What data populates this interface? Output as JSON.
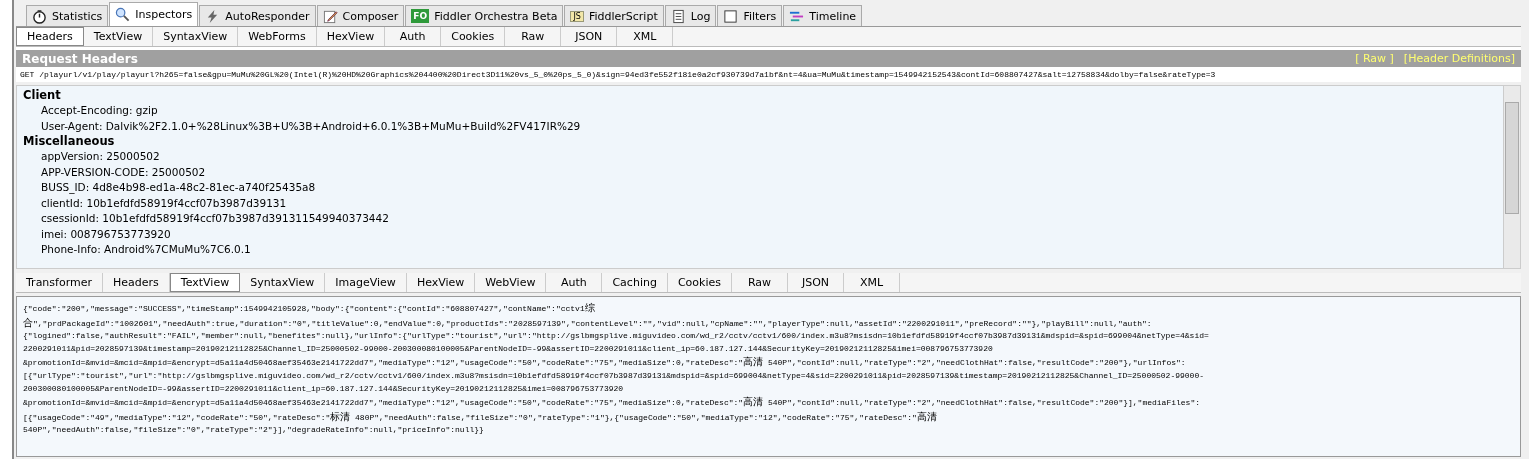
{
  "top_tabs": [
    {
      "label": "Statistics",
      "kind": "stopwatch",
      "selected": false
    },
    {
      "label": "Inspectors",
      "kind": "magnifier",
      "selected": true
    },
    {
      "label": "AutoResponder",
      "kind": "lightning",
      "selected": false
    },
    {
      "label": "Composer",
      "kind": "pencil",
      "selected": false
    },
    {
      "label": "Fiddler Orchestra Beta",
      "kind": "badge",
      "badge": "FO",
      "selected": false
    },
    {
      "label": "FiddlerScript",
      "kind": "script",
      "badge": "JS",
      "selected": false
    },
    {
      "label": "Log",
      "kind": "document",
      "selected": false
    },
    {
      "label": "Filters",
      "kind": "checkbox",
      "selected": false
    },
    {
      "label": "Timeline",
      "kind": "timeline",
      "selected": false
    }
  ],
  "request": {
    "tabs": [
      {
        "label": "Headers",
        "selected": true
      },
      {
        "label": "TextView",
        "selected": false
      },
      {
        "label": "SyntaxView",
        "selected": false
      },
      {
        "label": "WebForms",
        "selected": false
      },
      {
        "label": "HexView",
        "selected": false
      },
      {
        "label": "Auth",
        "selected": false
      },
      {
        "label": "Cookies",
        "selected": false
      },
      {
        "label": "Raw",
        "selected": false
      },
      {
        "label": "JSON",
        "selected": false
      },
      {
        "label": "XML",
        "selected": false
      }
    ],
    "title": "Request Headers",
    "links": [
      "[ Raw ]",
      "[Header Definitions]"
    ],
    "request_line": "GET /playurl/v1/play/playurl?h265=false&gpu=MuMu%20GL%20(Intel(R)%20HD%20Graphics%204400%20Direct3D11%20vs_5_0%20ps_5_0)&sign=94ed3fe552f181e0a2cf930739d7a1bf&nt=4&ua=MuMu&timestamp=1549942152543&contId=608807427&salt=12758834&dolby=false&rateType=3",
    "groups": [
      {
        "name": "Client",
        "headers": [
          "Accept-Encoding: gzip",
          "User-Agent: Dalvik%2F2.1.0+%28Linux%3B+U%3B+Android+6.0.1%3B+MuMu+Build%2FV417IR%29"
        ]
      },
      {
        "name": "Miscellaneous",
        "headers": [
          "appVersion: 25000502",
          "APP-VERSION-CODE: 25000502",
          "BUSS_ID: 4d8e4b98-ed1a-48c2-81ec-a740f25435a8",
          "clientId: 10b1efdfd58919f4ccf07b3987d39131",
          "csessionId: 10b1efdfd58919f4ccf07b3987d391311549940373442",
          "imei: 008796753773920",
          "Phone-Info: Android%7CMuMu%7C6.0.1"
        ]
      }
    ]
  },
  "response": {
    "tabs": [
      {
        "label": "Transformer",
        "selected": false
      },
      {
        "label": "Headers",
        "selected": false
      },
      {
        "label": "TextView",
        "selected": true
      },
      {
        "label": "SyntaxView",
        "selected": false
      },
      {
        "label": "ImageView",
        "selected": false
      },
      {
        "label": "HexView",
        "selected": false
      },
      {
        "label": "WebView",
        "selected": false
      },
      {
        "label": "Auth",
        "selected": false
      },
      {
        "label": "Caching",
        "selected": false
      },
      {
        "label": "Cookies",
        "selected": false
      },
      {
        "label": "Raw",
        "selected": false
      },
      {
        "label": "JSON",
        "selected": false
      },
      {
        "label": "XML",
        "selected": false
      }
    ],
    "body_lines": [
      "{\"code\":\"200\",\"message\":\"SUCCESS\",\"timeStamp\":1549942105928,\"body\":{\"content\":{\"contId\":\"608807427\",\"contName\":\"cctv1综",
      "合\",\"prdPackageId\":\"1002601\",\"needAuth\":true,\"duration\":\"0\",\"titleValue\":0,\"endValue\":0,\"productIds\":\"2028597139\",\"contentLevel\":\"\",\"vid\":null,\"cpName\":\"\",\"playerType\":null,\"assetId\":\"2200291011\",\"preRecord\":\"\"},\"playBill\":null,\"auth\":",
      "{\"logined\":false,\"authResult\":\"FAIL\",\"member\":null,\"benefites\":null},\"urlInfo\":{\"urlType\":\"tourist\",\"url\":\"http://gslbmgsplive.miguvideo.com/wd_r2/cctv/cctv1/600/index.m3u8?msisdn=10b1efdfd58919f4ccf07b3987d39131&mdspid=&spid=699004&netType=4&sid=",
      "2200291011&pid=2028597139&timestamp=20190212112825&Channel_ID=25000502-99000-200300080100005&ParentNodeID=-99&assertID=2200291011&client_ip=60.187.127.144&SecurityKey=20190212112825&imei=008796753773920",
      "&promotionId=&mvid=&mcid=&mpid=&encrypt=d5a11a4d50468aef35463e2141722dd7\",\"mediaType\":\"12\",\"usageCode\":\"50\",\"codeRate\":\"75\",\"mediaSize\":0,\"rateDesc\":\"高清 540P\",\"contId\":null,\"rateType\":\"2\",\"needClothHat\":false,\"resultCode\":\"200\"},\"urlInfos\":",
      "[{\"urlType\":\"tourist\",\"url\":\"http://gslbmgsplive.miguvideo.com/wd_r2/cctv/cctv1/600/index.m3u8?msisdn=10b1efdfd58919f4ccf07b3987d39131&mdspid=&spid=699004&netType=4&sid=2200291011&pid=2028597139&timestamp=20190212112825&Channel_ID=25000502-99000-",
      "200300080100005&ParentNodeID=-99&assertID=2200291011&client_ip=60.187.127.144&SecurityKey=20190212112825&imei=008796753773920",
      "&promotionId=&mvid=&mcid=&mpid=&encrypt=d5a11a4d50468aef35463e2141722dd7\",\"mediaType\":\"12\",\"usageCode\":\"50\",\"codeRate\":\"75\",\"mediaSize\":0,\"rateDesc\":\"高清 540P\",\"contId\":null,\"rateType\":\"2\",\"needClothHat\":false,\"resultCode\":\"200\"}],\"mediaFiles\":",
      "[{\"usageCode\":\"49\",\"mediaType\":\"12\",\"codeRate\":\"50\",\"rateDesc\":\"标清 480P\",\"needAuth\":false,\"fileSize\":\"0\",\"rateType\":\"1\"},{\"usageCode\":\"50\",\"mediaType\":\"12\",\"codeRate\":\"75\",\"rateDesc\":\"高清",
      "540P\",\"needAuth\":false,\"fileSize\":\"0\",\"rateType\":\"2\"}],\"degradeRateInfo\":null,\"priceInfo\":null}}"
    ]
  }
}
